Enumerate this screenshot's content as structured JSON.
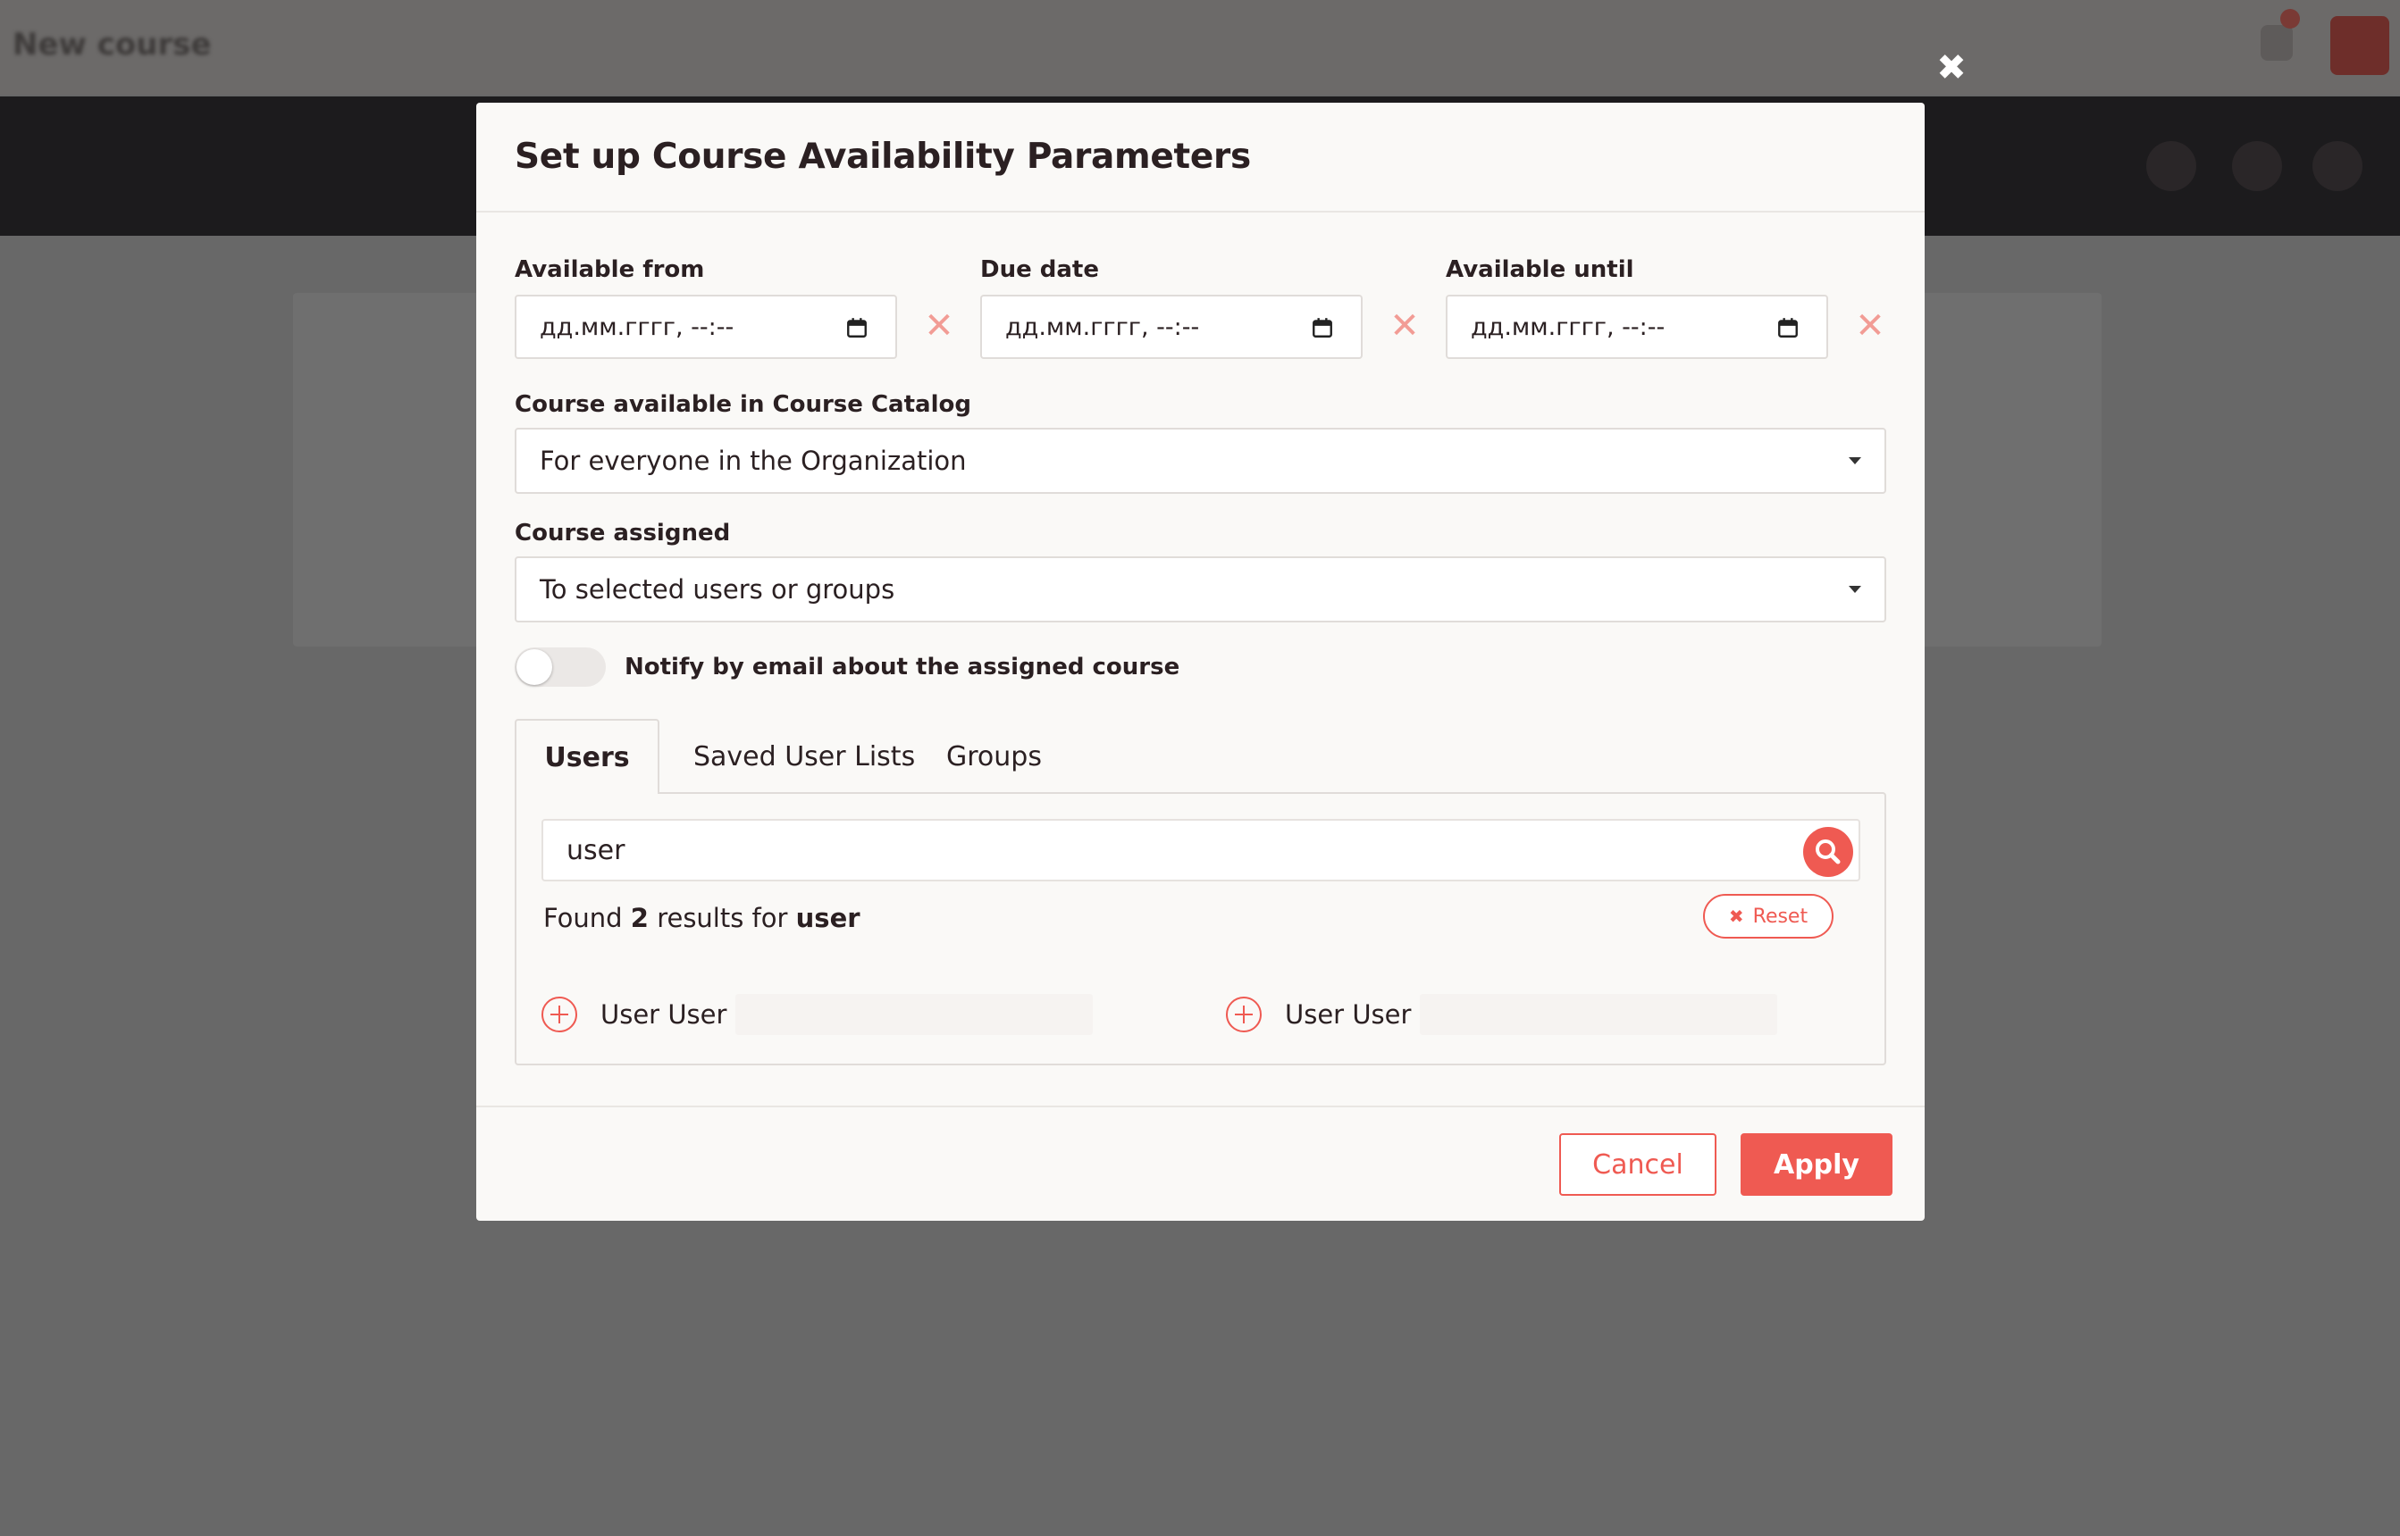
{
  "background": {
    "page_title": "New course"
  },
  "modal": {
    "title": "Set up Course Availability Parameters",
    "dates": {
      "available_from_label": "Available from",
      "available_from_value": "дд.мм.гггг, --:--",
      "due_date_label": "Due date",
      "due_date_value": "дд.мм.гггг, --:--",
      "available_until_label": "Available until",
      "available_until_value": "дд.мм.гггг, --:--",
      "clear_glyph": "✕"
    },
    "catalog": {
      "label": "Course available in Course Catalog",
      "value": "For everyone in the Organization"
    },
    "assigned": {
      "label": "Course assigned",
      "value": "To selected users or groups"
    },
    "notify": {
      "label": "Notify by email about the assigned course",
      "enabled": false
    },
    "tabs": [
      {
        "label": "Users",
        "active": true
      },
      {
        "label": "Saved User Lists",
        "active": false
      },
      {
        "label": "Groups",
        "active": false
      }
    ],
    "search": {
      "value": "user",
      "found_prefix": "Found",
      "count": "2",
      "found_middle": "results for",
      "query": "user",
      "reset_label": "Reset"
    },
    "results": [
      {
        "name": "User User"
      },
      {
        "name": "User User"
      }
    ],
    "footer": {
      "cancel_label": "Cancel",
      "apply_label": "Apply"
    },
    "close_glyph": "✖"
  },
  "colors": {
    "accent": "#ef5a52",
    "overlay": "#686868",
    "modal_bg": "#faf9f7",
    "text": "#2b2022"
  },
  "icons": [
    "close-icon",
    "calendar-icon",
    "clear-icon",
    "chevron-down-icon",
    "search-icon",
    "plus-circle-icon"
  ]
}
